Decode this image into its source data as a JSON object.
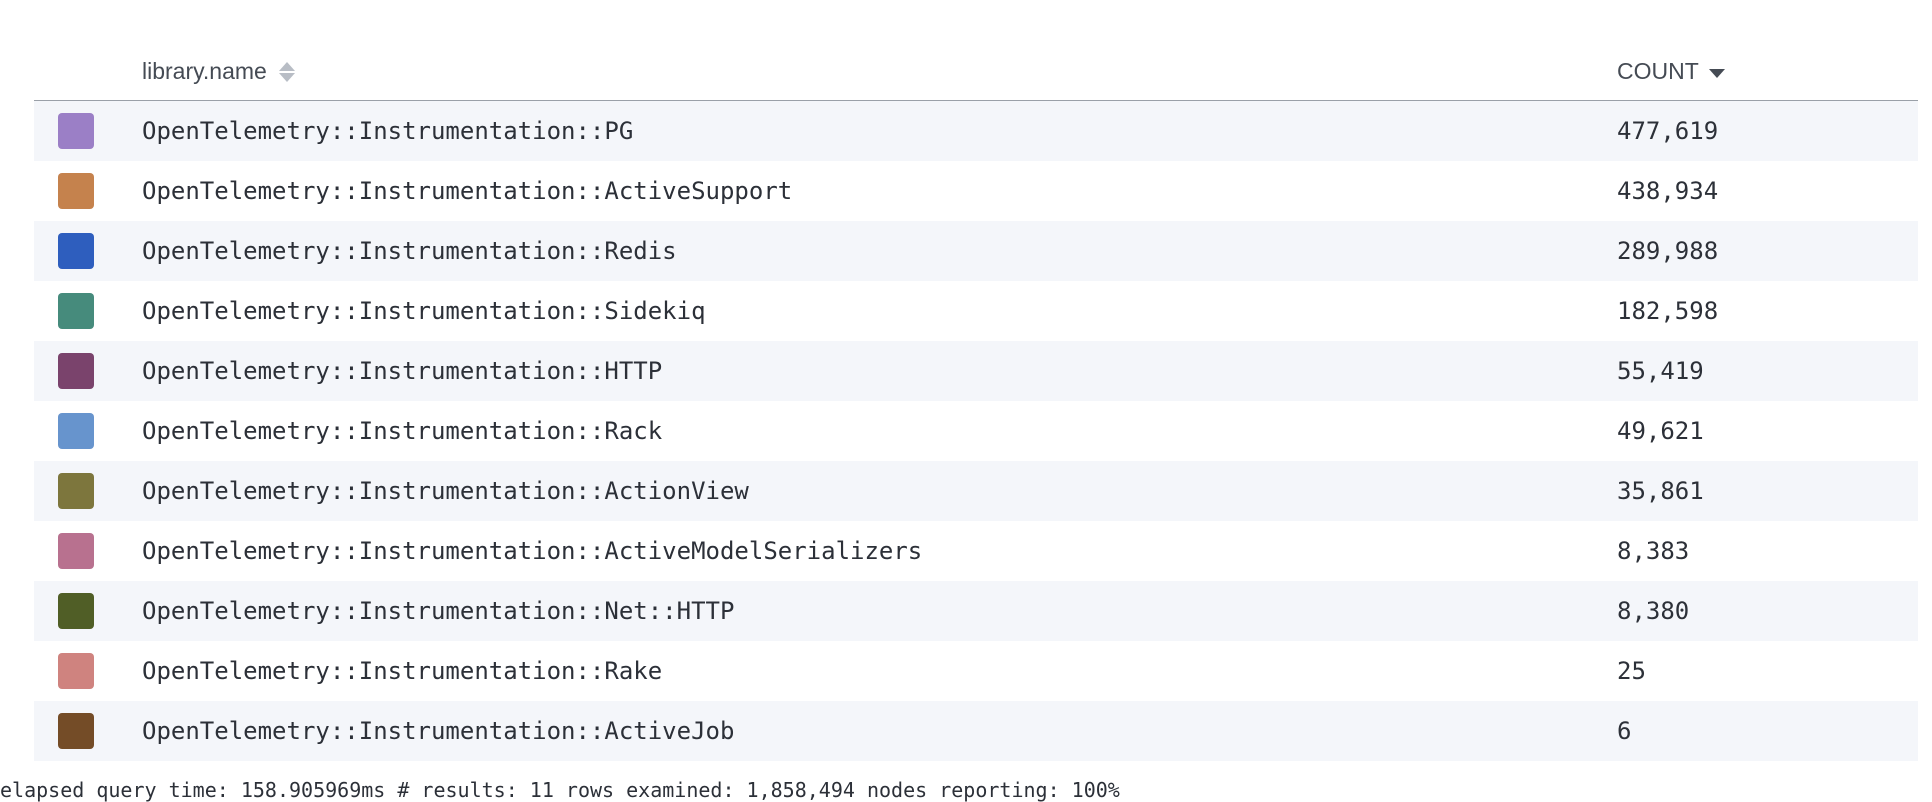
{
  "table": {
    "columns": {
      "name": "library.name",
      "count": "COUNT"
    },
    "rows": [
      {
        "name": "OpenTelemetry::Instrumentation::PG",
        "count": "477,619",
        "color": "#9b7fc6"
      },
      {
        "name": "OpenTelemetry::Instrumentation::ActiveSupport",
        "count": "438,934",
        "color": "#c5824d"
      },
      {
        "name": "OpenTelemetry::Instrumentation::Redis",
        "count": "289,988",
        "color": "#2e5ebe"
      },
      {
        "name": "OpenTelemetry::Instrumentation::Sidekiq",
        "count": "182,598",
        "color": "#468b7c"
      },
      {
        "name": "OpenTelemetry::Instrumentation::HTTP",
        "count": "55,419",
        "color": "#7a436c"
      },
      {
        "name": "OpenTelemetry::Instrumentation::Rack",
        "count": "49,621",
        "color": "#6794cd"
      },
      {
        "name": "OpenTelemetry::Instrumentation::ActionView",
        "count": "35,861",
        "color": "#7d763d"
      },
      {
        "name": "OpenTelemetry::Instrumentation::ActiveModelSerializers",
        "count": "8,383",
        "color": "#b8718f"
      },
      {
        "name": "OpenTelemetry::Instrumentation::Net::HTTP",
        "count": "8,380",
        "color": "#505e26"
      },
      {
        "name": "OpenTelemetry::Instrumentation::Rake",
        "count": "25",
        "color": "#cf837f"
      },
      {
        "name": "OpenTelemetry::Instrumentation::ActiveJob",
        "count": "6",
        "color": "#744c27"
      }
    ]
  },
  "footer": {
    "text": "elapsed query time: 158.905969ms   # results: 11   rows examined: 1,858,494   nodes reporting: 100%"
  }
}
